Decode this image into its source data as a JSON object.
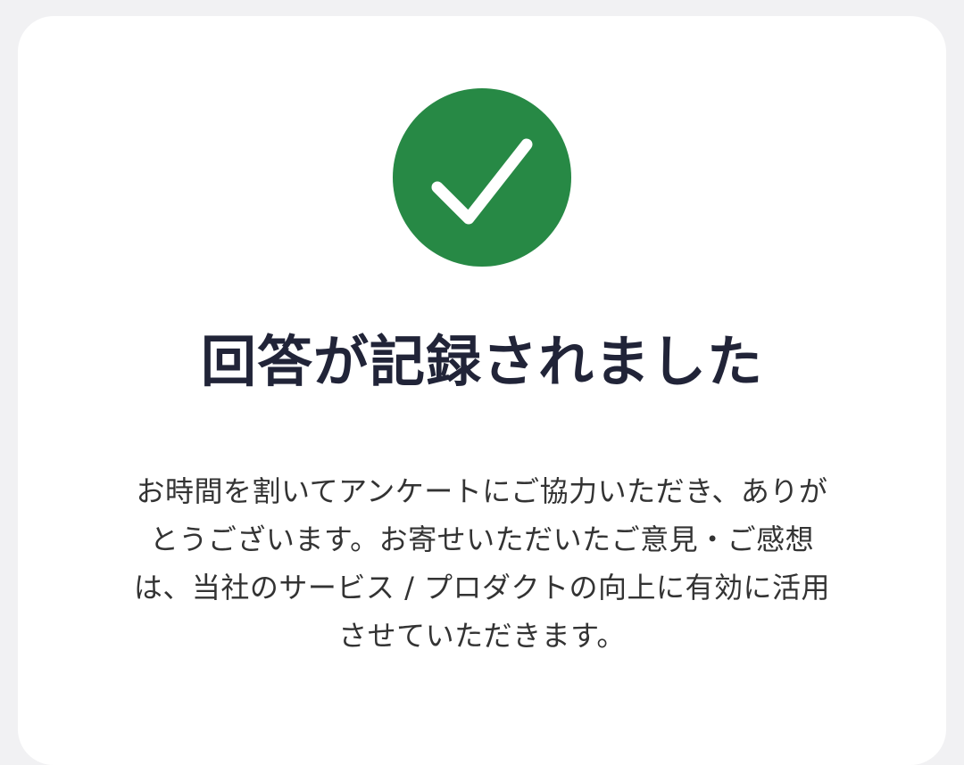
{
  "confirmation": {
    "icon": "check-icon",
    "icon_color": "#278945",
    "title": "回答が記録されました",
    "message_lines": [
      "お時間を割いてアンケートにご協力いただき、ありが",
      "とうございます。お寄せいただいたご意見・ご感想",
      "は、当社のサービス / プロダクトの向上に有効に活用",
      "させていただきます。"
    ]
  }
}
